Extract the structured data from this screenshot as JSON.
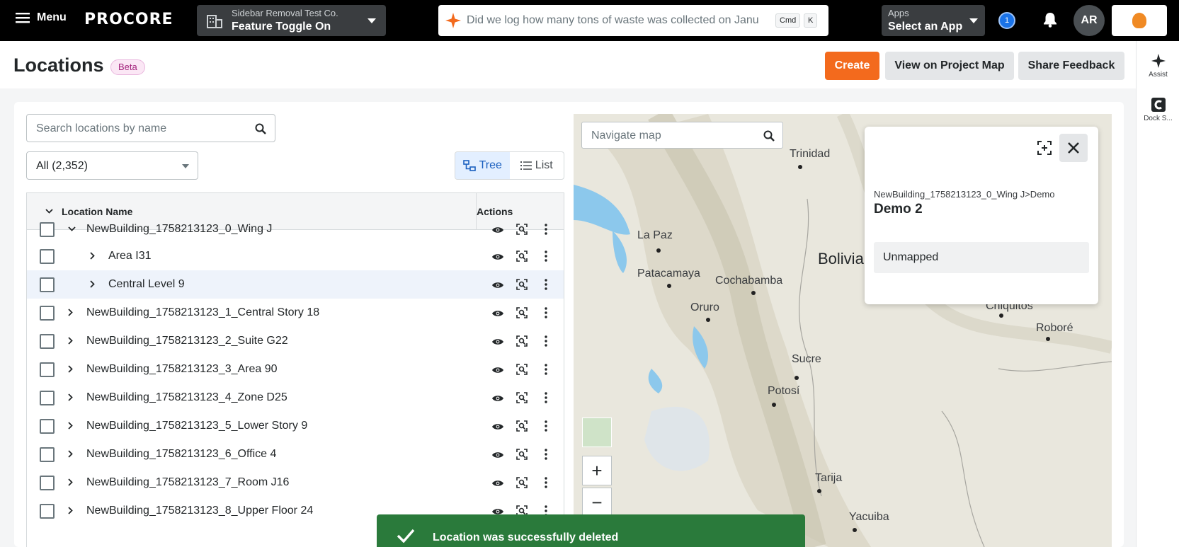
{
  "topbar": {
    "menu_label": "Menu",
    "logo_text": "PROCORE",
    "project_company": "Sidebar Removal Test Co.",
    "project_name": "Feature Toggle On",
    "search_text": "Did we log how many tons of waste was collected on Janu",
    "kbd_cmd": "Cmd",
    "kbd_k": "K",
    "apps_label": "Apps",
    "apps_value": "Select an App",
    "notif_count": "1",
    "avatar_initials": "AR"
  },
  "rail": {
    "assist_label": "Assist",
    "dock_label": "Dock S..."
  },
  "header": {
    "title": "Locations",
    "badge": "Beta",
    "create_label": "Create",
    "view_map_label": "View on Project Map",
    "feedback_label": "Share Feedback"
  },
  "list": {
    "search_placeholder": "Search locations by name",
    "filter_value": "All (2,352)",
    "view_tree_label": "Tree",
    "view_list_label": "List",
    "col_name": "Location Name",
    "col_actions": "Actions",
    "rows": [
      {
        "name": "NewBuilding_1758213123_0_Wing J",
        "level": 0,
        "expanded": true
      },
      {
        "name": "Area I31",
        "level": 1,
        "expanded": false
      },
      {
        "name": "Central Level 9",
        "level": 1,
        "expanded": false,
        "highlighted": true
      },
      {
        "name": "NewBuilding_1758213123_1_Central Story 18",
        "level": 0,
        "expanded": false
      },
      {
        "name": "NewBuilding_1758213123_2_Suite G22",
        "level": 0,
        "expanded": false
      },
      {
        "name": "NewBuilding_1758213123_3_Area 90",
        "level": 0,
        "expanded": false
      },
      {
        "name": "NewBuilding_1758213123_4_Zone D25",
        "level": 0,
        "expanded": false
      },
      {
        "name": "NewBuilding_1758213123_5_Lower Story 9",
        "level": 0,
        "expanded": false
      },
      {
        "name": "NewBuilding_1758213123_6_Office 4",
        "level": 0,
        "expanded": false
      },
      {
        "name": "NewBuilding_1758213123_7_Room J16",
        "level": 0,
        "expanded": false
      },
      {
        "name": "NewBuilding_1758213123_8_Upper Floor 24",
        "level": 0,
        "expanded": false
      }
    ]
  },
  "map": {
    "search_placeholder": "Navigate map",
    "zoom_in": "+",
    "zoom_out": "−",
    "cities": [
      "Trinidad",
      "La Paz",
      "Bolivia",
      "Patacamaya",
      "Cochabamba",
      "Oruro",
      "Chiquitos",
      "Roboré",
      "Sucre",
      "Potosí",
      "Tarija",
      "Yacuiba"
    ]
  },
  "popup": {
    "path": "NewBuilding_1758213123_0_Wing J>Demo",
    "title": "Demo 2",
    "status": "Unmapped"
  },
  "toast": {
    "message": "Location was successfully deleted"
  },
  "colors": {
    "brand": "#f36a1d",
    "toast": "#2a7a3b",
    "selected_view": "#1a5fbf"
  }
}
